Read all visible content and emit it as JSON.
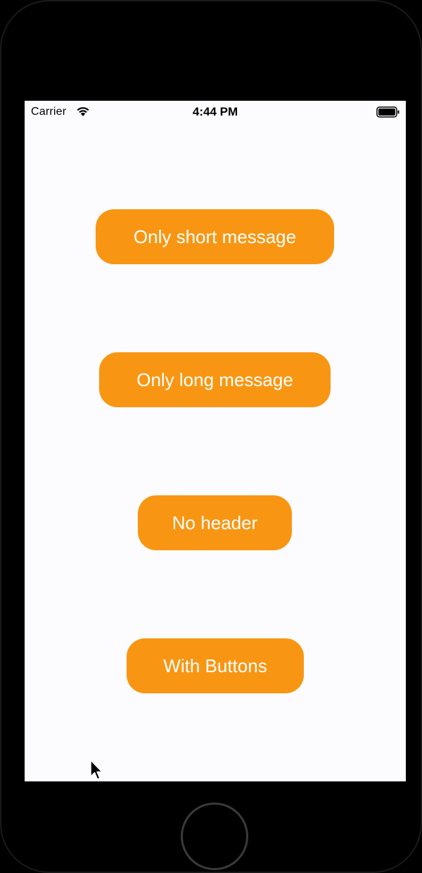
{
  "status_bar": {
    "carrier": "Carrier",
    "time": "4:44 PM"
  },
  "buttons": [
    {
      "label": "Only short message"
    },
    {
      "label": "Only long message"
    },
    {
      "label": "No header"
    },
    {
      "label": "With Buttons"
    }
  ],
  "colors": {
    "button_background": "#f89613",
    "button_text": "#ffffff",
    "screen_background": "#fcfbfd"
  },
  "icons": [
    "wifi-icon",
    "battery-icon",
    "mouse-cursor-icon",
    "home-button"
  ]
}
